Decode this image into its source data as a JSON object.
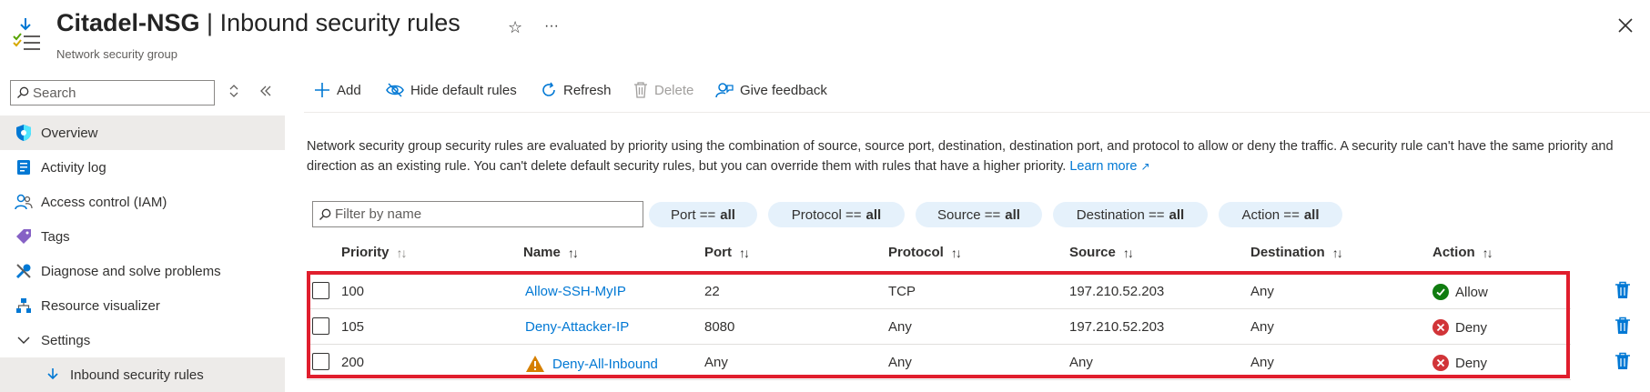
{
  "header": {
    "resource_name": "Citadel-NSG",
    "separator": " | ",
    "page_title": "Inbound security rules",
    "subtitle": "Network security group",
    "favorite_glyph": "☆",
    "more_glyph": "···"
  },
  "sidebar": {
    "search_placeholder": "Search",
    "items": [
      {
        "label": "Overview",
        "icon": "shield-icon"
      },
      {
        "label": "Activity log",
        "icon": "log-icon"
      },
      {
        "label": "Access control (IAM)",
        "icon": "people-icon"
      },
      {
        "label": "Tags",
        "icon": "tag-icon"
      },
      {
        "label": "Diagnose and solve problems",
        "icon": "wrench-icon"
      },
      {
        "label": "Resource visualizer",
        "icon": "hierarchy-icon"
      },
      {
        "label": "Settings",
        "icon": "chevron-down-icon"
      },
      {
        "label": "Inbound security rules",
        "icon": "download-icon"
      }
    ]
  },
  "toolbar": {
    "add": "Add",
    "hide_default": "Hide default rules",
    "refresh": "Refresh",
    "delete": "Delete",
    "feedback": "Give feedback"
  },
  "description": {
    "text": "Network security group security rules are evaluated by priority using the combination of source, source port, destination, destination port, and protocol to allow or deny the traffic. A security rule can't have the same priority and direction as an existing rule. You can't delete default security rules, but you can override them with rules that have a higher priority.",
    "link": "Learn more"
  },
  "filters": {
    "name_placeholder": "Filter by name",
    "pills": [
      {
        "label": "Port ==",
        "value": "all"
      },
      {
        "label": "Protocol ==",
        "value": "all"
      },
      {
        "label": "Source ==",
        "value": "all"
      },
      {
        "label": "Destination ==",
        "value": "all"
      },
      {
        "label": "Action ==",
        "value": "all"
      }
    ]
  },
  "table": {
    "columns": [
      "Priority",
      "Name",
      "Port",
      "Protocol",
      "Source",
      "Destination",
      "Action"
    ],
    "sort_glyph": "↑↓",
    "rows": [
      {
        "priority": "100",
        "name": "Allow-SSH-MyIP",
        "port": "22",
        "protocol": "TCP",
        "source": "197.210.52.203",
        "destination": "Any",
        "action": "Allow",
        "warning": false
      },
      {
        "priority": "105",
        "name": "Deny-Attacker-IP",
        "port": "8080",
        "protocol": "Any",
        "source": "197.210.52.203",
        "destination": "Any",
        "action": "Deny",
        "warning": false
      },
      {
        "priority": "200",
        "name": "Deny-All-Inbound",
        "port": "Any",
        "protocol": "Any",
        "source": "Any",
        "destination": "Any",
        "action": "Deny",
        "warning": true
      }
    ]
  },
  "colors": {
    "accent": "#0078d4",
    "allow": "#107c10",
    "deny": "#d13438",
    "warning": "#d67f00",
    "highlight": "#e01e2d",
    "pill_bg": "#e5f1fb"
  }
}
